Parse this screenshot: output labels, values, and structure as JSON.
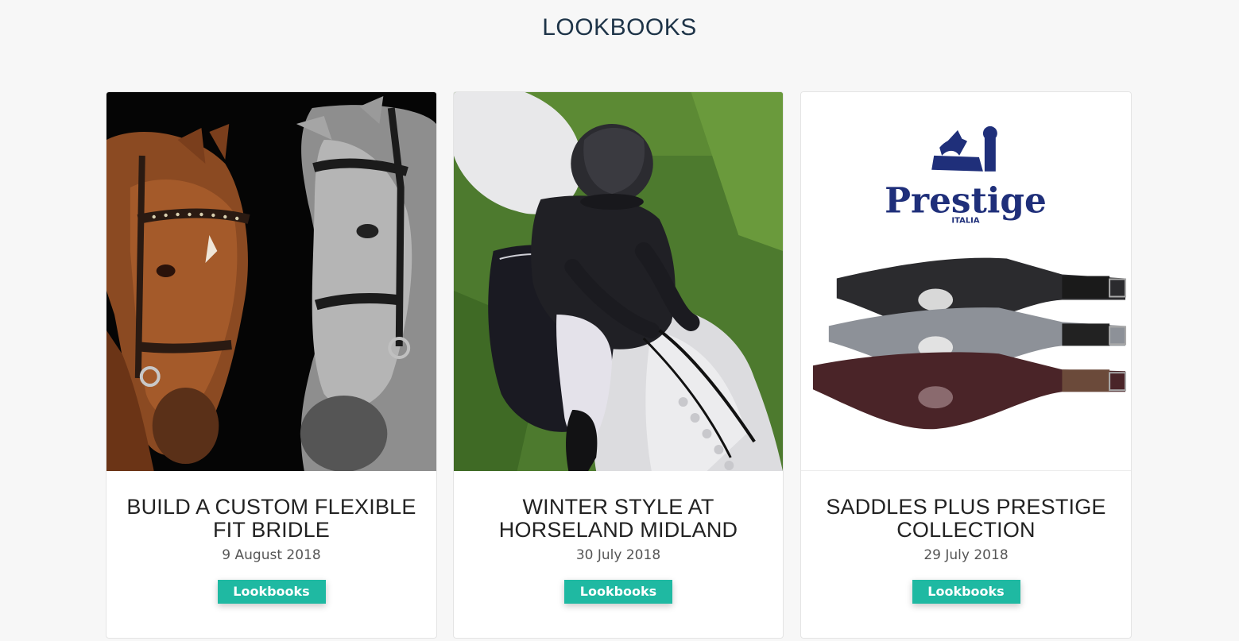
{
  "section": {
    "title": "LOOKBOOKS"
  },
  "cards": [
    {
      "title": "BUILD A CUSTOM FLEXIBLE FIT BRIDLE",
      "date": "9 August 2018",
      "button_label": "Lookbooks",
      "image": "two-horses-bridles-photo"
    },
    {
      "title": "WINTER STYLE AT HORSELAND MIDLAND",
      "date": "30 July 2018",
      "button_label": "Lookbooks",
      "image": "rider-on-grey-horse-photo"
    },
    {
      "title": "SADDLES PLUS PRESTIGE COLLECTION",
      "date": "29 July 2018",
      "button_label": "Lookbooks",
      "image": "prestige-girths-photo"
    }
  ],
  "brand": {
    "logo_text": "Prestige",
    "logo_subtext": "ITALIA",
    "logo_color": "#1f2f7a"
  },
  "colors": {
    "accent": "#1fb9a2",
    "heading": "#1e3448",
    "background": "#f7f7f7"
  }
}
